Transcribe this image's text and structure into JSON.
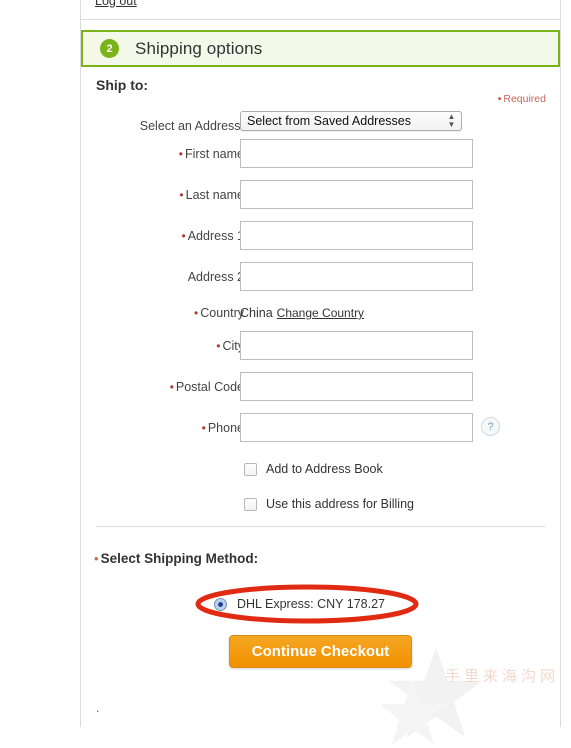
{
  "top": {
    "logout_label": "Log out"
  },
  "section": {
    "step_number": "2",
    "title": "Shipping options"
  },
  "form": {
    "ship_to_heading": "Ship to:",
    "required_marker": "•",
    "required_note": "Required",
    "select_address": {
      "label": "Select an Address:",
      "value": "Select from Saved Addresses",
      "arrow_glyph": "▲▼"
    },
    "fields": [
      {
        "label": "First name",
        "required": true,
        "value": "",
        "placeholder": ""
      },
      {
        "label": "Last name",
        "required": true,
        "value": "",
        "placeholder": ""
      },
      {
        "label": "Address 1",
        "required": true,
        "value": "",
        "placeholder": ""
      },
      {
        "label": "Address 2",
        "required": false,
        "value": "",
        "placeholder": ""
      }
    ],
    "country": {
      "label": "Country",
      "value": "China",
      "change_link": "Change Country"
    },
    "fields2": [
      {
        "label": "City",
        "required": true,
        "value": "",
        "placeholder": ""
      },
      {
        "label": "Postal Code",
        "required": true,
        "value": "",
        "placeholder": ""
      },
      {
        "label": "Phone",
        "required": true,
        "value": "",
        "placeholder": ""
      }
    ],
    "help_icon_glyph": "?",
    "checkboxes": [
      {
        "label": "Add to Address Book",
        "checked": false
      },
      {
        "label": "Use this address for Billing",
        "checked": false
      }
    ]
  },
  "shipping_method": {
    "label": "Select Shipping Method:",
    "required_marker": "•",
    "options": [
      {
        "label": "DHL Express: CNY 178.27",
        "selected": true,
        "carrier": "DHL Express",
        "currency": "CNY",
        "price": "178.27"
      }
    ]
  },
  "actions": {
    "continue_label": "Continue Checkout"
  },
  "watermark": {
    "text": "手里来海沟网"
  },
  "footer": {
    "trailing_dot": "."
  },
  "colors": {
    "accent_green": "#7ab317",
    "header_bg": "#f3f8e8",
    "button_orange": "#f5a623",
    "required_red": "#cc6655",
    "annotation_red": "#e02b12",
    "radio_blue": "#1f3d8f"
  }
}
